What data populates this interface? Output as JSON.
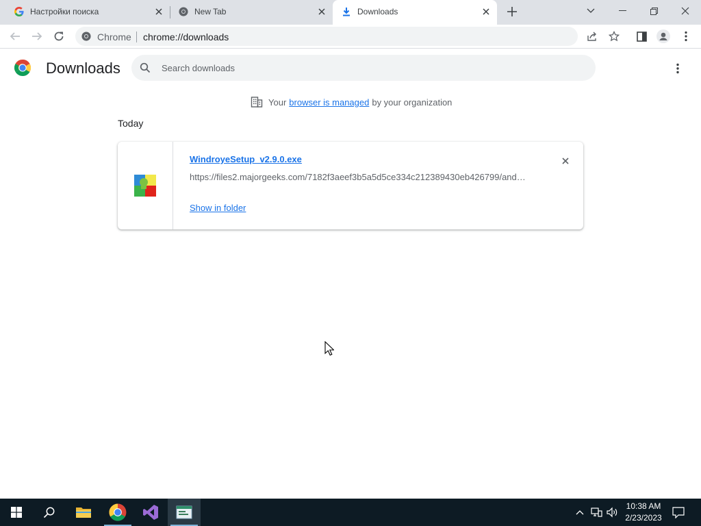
{
  "tabs": [
    {
      "title": "Настройки поиска",
      "favicon": "google-g-icon",
      "active": false
    },
    {
      "title": "New Tab",
      "favicon": "chrome-icon",
      "active": false
    },
    {
      "title": "Downloads",
      "favicon": "download-icon",
      "active": true
    }
  ],
  "omnibox": {
    "scheme_label": "Chrome",
    "url": "chrome://downloads"
  },
  "page": {
    "title": "Downloads",
    "search_placeholder": "Search downloads",
    "managed": {
      "prefix": "Your",
      "link": "browser is managed",
      "suffix": "by your organization"
    },
    "date_group": "Today",
    "downloads": [
      {
        "file_name": "WindroyeSetup_v2.9.0.exe",
        "url": "https://files2.majorgeeks.com/7182f3aeef3b5a5d5ce334c212389430eb426799/and…",
        "action": "Show in folder"
      }
    ]
  },
  "taskbar": {
    "time": "10:38 AM",
    "date": "2/23/2023",
    "apps": [
      "windows-start-icon",
      "search-icon",
      "file-explorer-icon",
      "chrome-icon",
      "visual-studio-icon",
      "app-window-icon"
    ]
  },
  "colors": {
    "link": "#1a73e8",
    "tabstrip": "#dee1e6",
    "taskbar": "#0d1b24"
  }
}
